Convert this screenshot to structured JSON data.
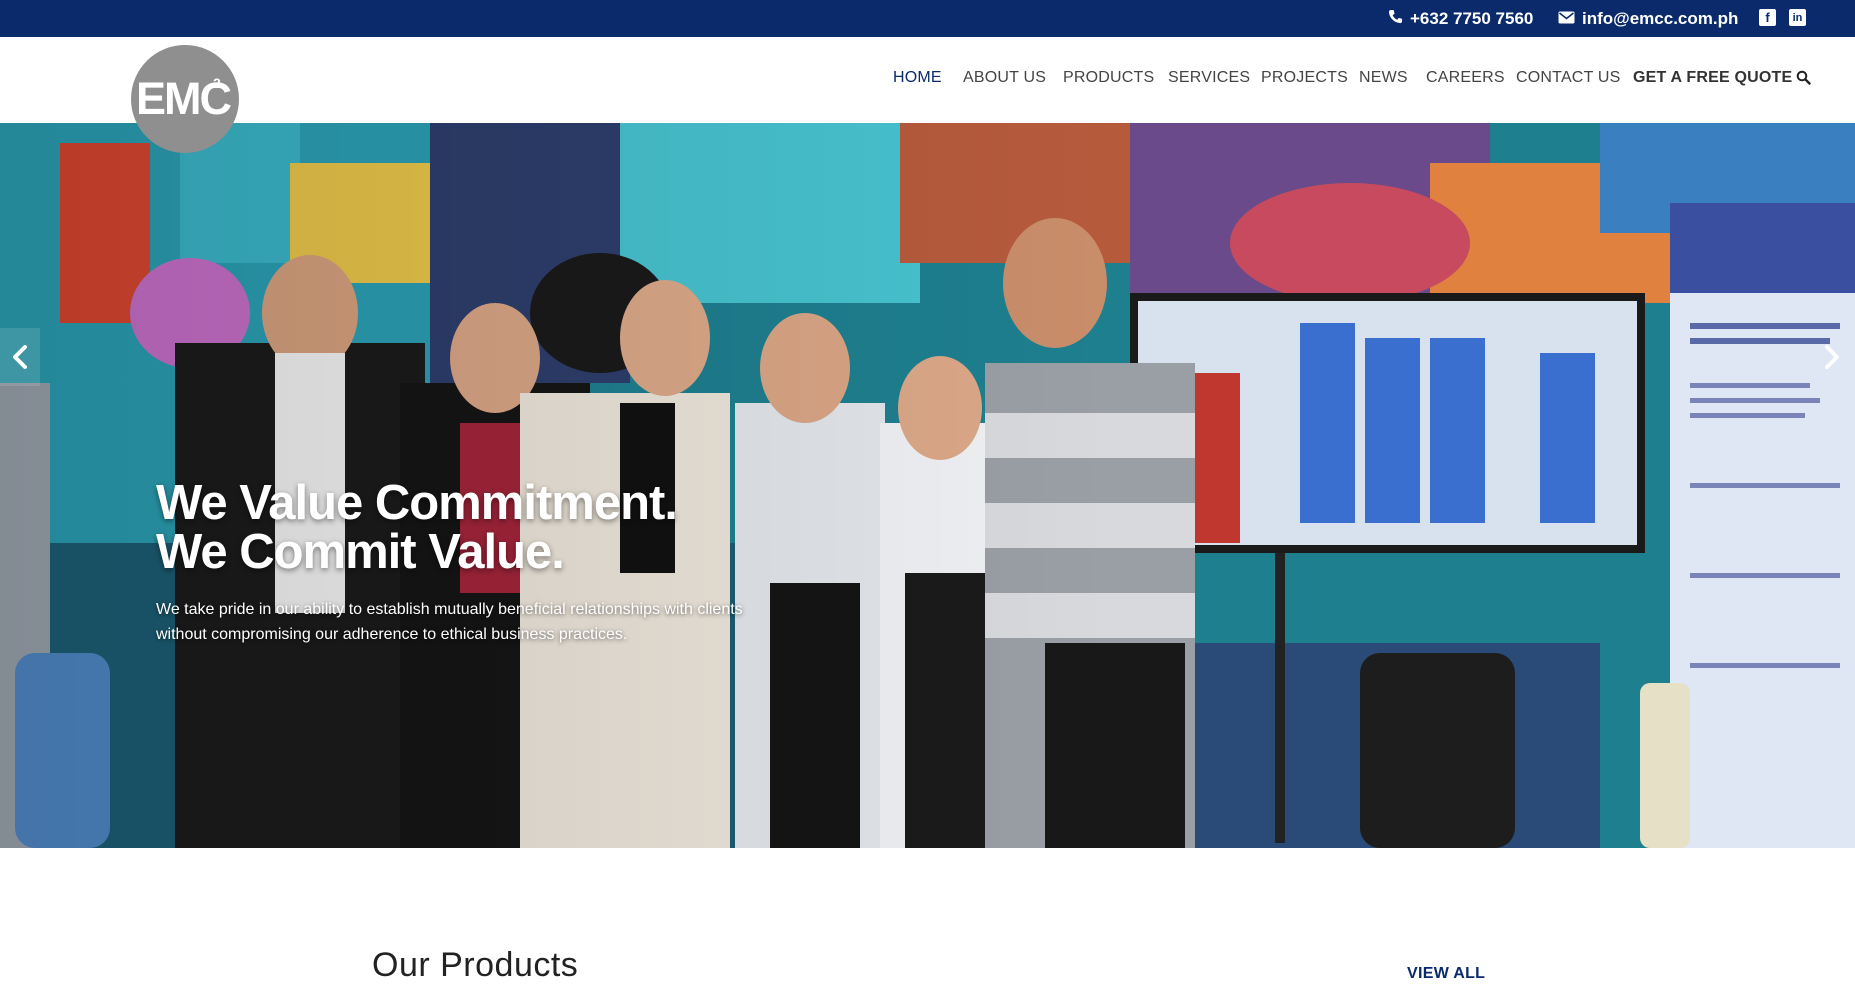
{
  "topbar": {
    "phone": "+632 7750 7560",
    "email": "info@emcc.com.ph",
    "social": [
      "facebook-icon",
      "linkedin-icon"
    ],
    "bg_color": "#0a2a6b"
  },
  "logo": {
    "text": "EMC",
    "sup": "2"
  },
  "nav": {
    "items": [
      "HOME",
      "ABOUT US",
      "PRODUCTS",
      "SERVICES",
      "PROJECTS",
      "NEWS",
      "CAREERS",
      "CONTACT US"
    ],
    "active": "HOME",
    "cta": "GET A FREE QUOTE",
    "search_icon": "search-icon"
  },
  "hero": {
    "headline_line1": "We Value Commitment.",
    "headline_line2": "We Commit Value.",
    "subtext_line1": "We take pride in our ability to establish mutually beneficial relationships with clients",
    "subtext_line2": "without compromising our adherence to ethical business practices.",
    "prev_icon": "chevron-left-icon",
    "next_icon": "chevron-right-icon"
  },
  "products": {
    "title": "Our Products",
    "view_all": "VIEW ALL"
  }
}
